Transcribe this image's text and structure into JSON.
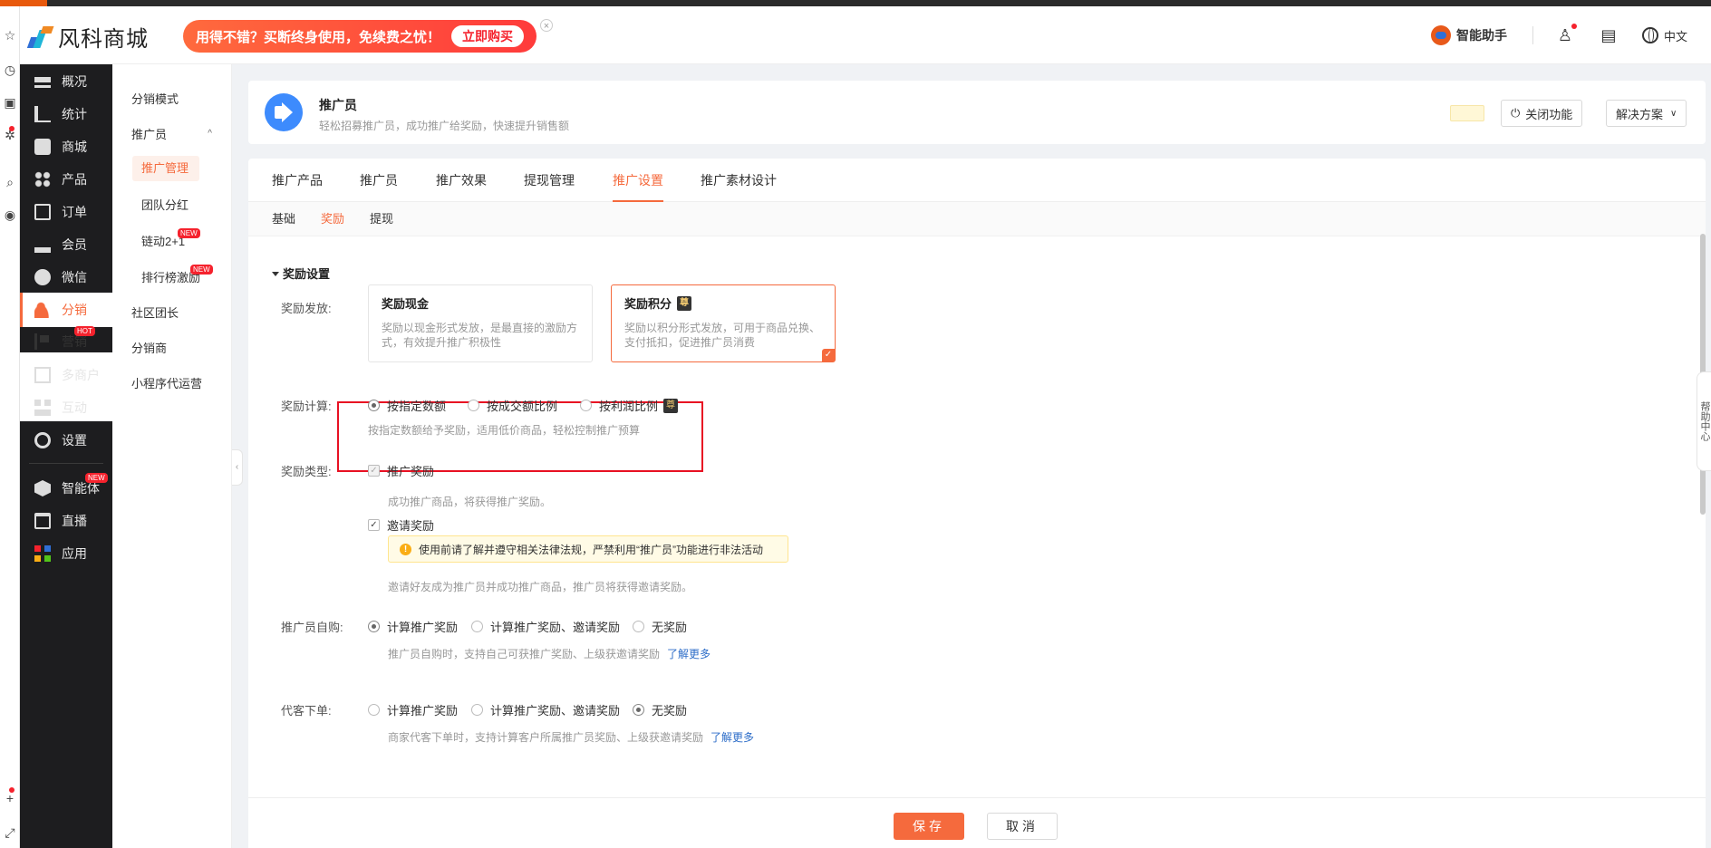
{
  "brand": {
    "name": "风科商城"
  },
  "promo": {
    "text": "用得不错？买断终身使用，免续费之忧！",
    "button": "立即购买",
    "close": "×"
  },
  "header": {
    "assistant": "智能助手",
    "language": "中文"
  },
  "primary_nav": [
    {
      "label": "概况"
    },
    {
      "label": "统计"
    },
    {
      "label": "商城"
    },
    {
      "label": "产品"
    },
    {
      "label": "订单"
    },
    {
      "label": "会员"
    },
    {
      "label": "微信"
    },
    {
      "label": "分销"
    },
    {
      "label": "营销",
      "badge": "HOT"
    },
    {
      "label": "多商户"
    },
    {
      "label": "互动"
    },
    {
      "label": "设置"
    },
    {
      "label": "智能体",
      "badge": "NEW"
    },
    {
      "label": "直播"
    },
    {
      "label": "应用"
    }
  ],
  "secondary_nav": [
    {
      "label": "分销模式"
    },
    {
      "label": "推广员",
      "chevron": "^"
    },
    {
      "label": "推广管理"
    },
    {
      "label": "团队分红"
    },
    {
      "label": "链动2+1",
      "badge": "NEW"
    },
    {
      "label": "排行榜激励",
      "badge": "NEW"
    },
    {
      "label": "社区团长"
    },
    {
      "label": "分销商"
    },
    {
      "label": "小程序代运营"
    }
  ],
  "app": {
    "title": "推广员",
    "description": "轻松招募推广员，成功推广给奖励，快速提升销售额",
    "close_button": "关闭功能",
    "solution_button": "解决方案"
  },
  "tabs": [
    "推广产品",
    "推广员",
    "推广效果",
    "提现管理",
    "推广设置",
    "推广素材设计"
  ],
  "subtabs": [
    "基础",
    "奖励",
    "提现"
  ],
  "section_title": "奖励设置",
  "form": {
    "issue_label": "奖励发放:",
    "issue_cards": [
      {
        "title": "奖励现金",
        "desc": "奖励以现金形式发放，是最直接的激励方式，有效提升推广积极性"
      },
      {
        "title": "奖励积分",
        "desc": "奖励以积分形式发放，可用于商品兑换、支付抵扣，促进推广员消费",
        "tag": "尊"
      }
    ],
    "calc_label": "奖励计算:",
    "calc_options": [
      "按指定数额",
      "按成交额比例",
      "按利润比例"
    ],
    "calc_tag": "尊",
    "calc_hint": "按指定数额给予奖励，适用低价商品，轻松控制推广预算",
    "type_label": "奖励类型:",
    "type_promo": "推广奖励",
    "type_promo_hint": "成功推广商品，将获得推广奖励。",
    "type_invite": "邀请奖励",
    "warning": "使用前请了解并遵守相关法律法规，严禁利用“推广员”功能进行非法活动",
    "type_invite_hint": "邀请好友成为推广员并成功推广商品，推广员将获得邀请奖励。",
    "self_label": "推广员自购:",
    "self_options": [
      "计算推广奖励",
      "计算推广奖励、邀请奖励",
      "无奖励"
    ],
    "self_hint": "推广员自购时，支持自己可获推广奖励、上级获邀请奖励",
    "self_link": "了解更多",
    "proxy_label": "代客下单:",
    "proxy_options": [
      "计算推广奖励",
      "计算推广奖励、邀请奖励",
      "无奖励"
    ],
    "proxy_hint": "商家代客下单时，支持计算客户所属推广员奖励、上级获邀请奖励",
    "proxy_link": "了解更多"
  },
  "footer": {
    "save": "保存",
    "cancel": "取消"
  },
  "help": "帮助中心"
}
